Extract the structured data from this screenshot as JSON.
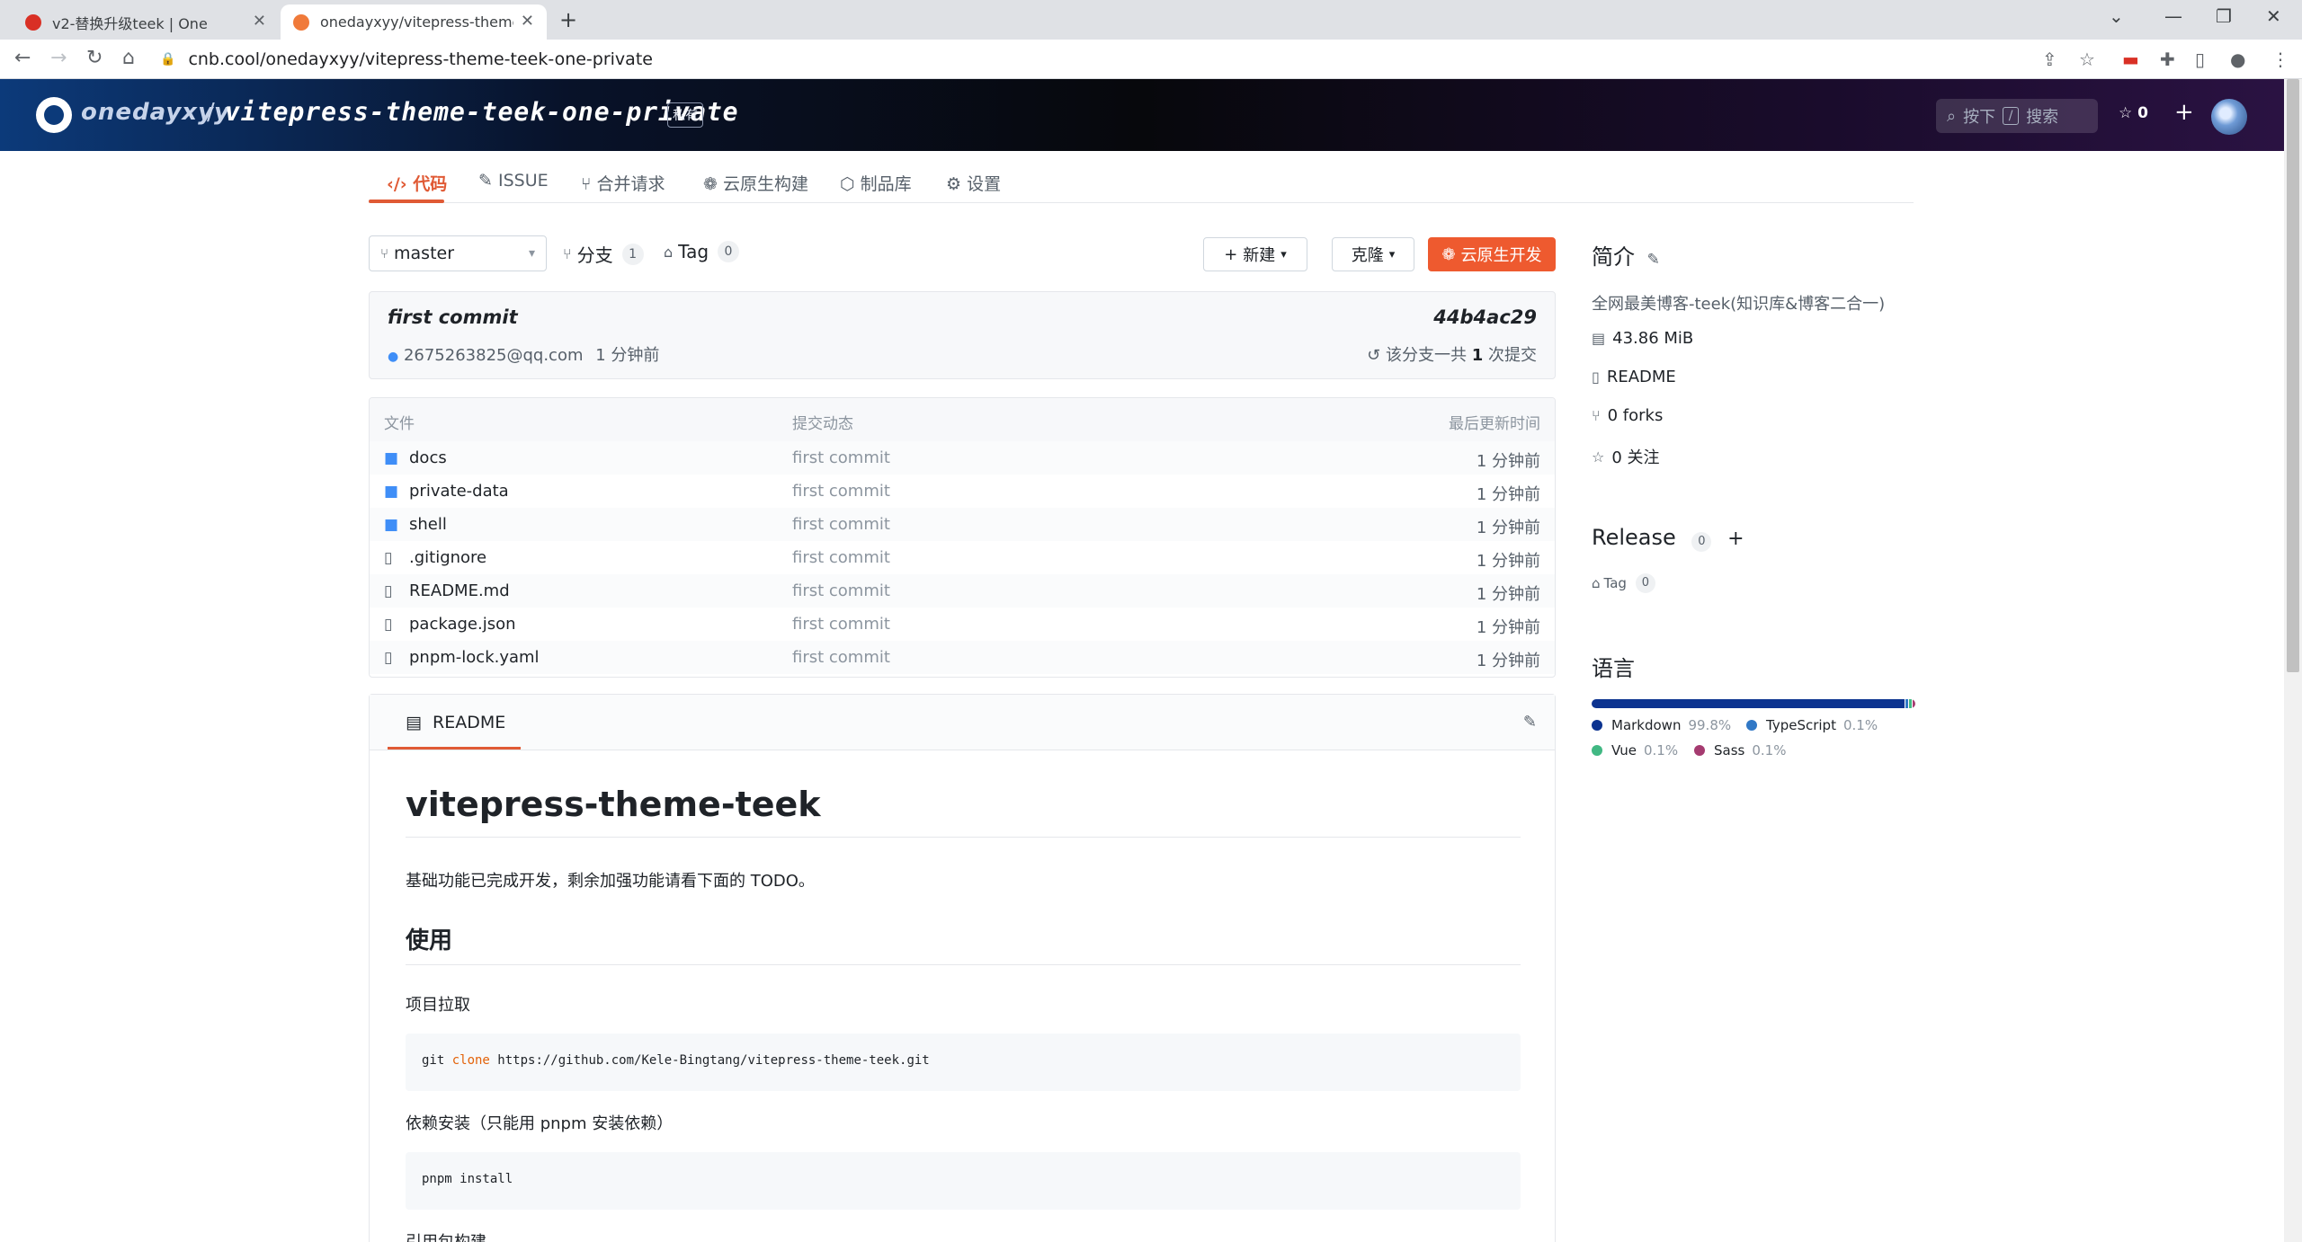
{
  "browser": {
    "tabs": [
      {
        "title": "v2-替换升级teek | One",
        "active": false
      },
      {
        "title": "onedayxyy/vitepress-theme-teek-one-private",
        "active": true
      }
    ],
    "url": "cnb.cool/onedayxyy/vitepress-theme-teek-one-private"
  },
  "header": {
    "owner": "onedayxyy",
    "separator": "/",
    "repo": "vitepress-theme-teek-one-private",
    "visibility_badge": "私有",
    "search_prefix": "按下",
    "search_key": "/",
    "search_suffix": "搜索",
    "star_count": "0"
  },
  "repo_tabs": [
    {
      "label": "代码",
      "icon": "code-icon",
      "active": true
    },
    {
      "label": "ISSUE",
      "icon": "issue-icon",
      "active": false
    },
    {
      "label": "合并请求",
      "icon": "merge-request-icon",
      "active": false
    },
    {
      "label": "云原生构建",
      "icon": "build-icon",
      "active": false
    },
    {
      "label": "制品库",
      "icon": "package-icon",
      "active": false
    },
    {
      "label": "设置",
      "icon": "settings-icon",
      "active": false
    }
  ],
  "branch_bar": {
    "branch": "master",
    "branches_label": "分支",
    "branches_count": "1",
    "tags_label": "Tag",
    "tags_count": "0",
    "new_label": "新建",
    "clone_label": "克隆",
    "cloud_dev_label": "云原生开发"
  },
  "commit": {
    "message": "first commit",
    "hash": "44b4ac29",
    "author": "2675263825@qq.com",
    "time": "1 分钟前",
    "total_prefix": "该分支一共",
    "total_count": "1",
    "total_suffix": "次提交"
  },
  "files": {
    "headers": {
      "name": "文件",
      "message": "提交动态",
      "time": "最后更新时间"
    },
    "rows": [
      {
        "name": "docs",
        "type": "folder",
        "message": "first commit",
        "time": "1 分钟前"
      },
      {
        "name": "private-data",
        "type": "folder",
        "message": "first commit",
        "time": "1 分钟前"
      },
      {
        "name": "shell",
        "type": "folder",
        "message": "first commit",
        "time": "1 分钟前"
      },
      {
        "name": ".gitignore",
        "type": "file",
        "message": "first commit",
        "time": "1 分钟前"
      },
      {
        "name": "README.md",
        "type": "file",
        "message": "first commit",
        "time": "1 分钟前"
      },
      {
        "name": "package.json",
        "type": "file",
        "message": "first commit",
        "time": "1 分钟前"
      },
      {
        "name": "pnpm-lock.yaml",
        "type": "file",
        "message": "first commit",
        "time": "1 分钟前"
      }
    ]
  },
  "readme": {
    "tab_label": "README",
    "h1": "vitepress-theme-teek",
    "intro": "基础功能已完成开发，剩余加强功能请看下面的 TODO。",
    "h2_usage": "使用",
    "step1": "项目拉取",
    "code1_cmd": "git ",
    "code1_kw": "clone",
    "code1_rest": " https://github.com/Kele-Bingtang/vitepress-theme-teek.git",
    "step2": "依赖安装（只能用 pnpm 安装依赖）",
    "code2": "pnpm install",
    "step3": "引用包构建"
  },
  "sidebar": {
    "about_title": "简介",
    "description": "全网最美博客-teek(知识库&博客二合一)",
    "size": "43.86 MiB",
    "readme_link": "README",
    "forks": "0 forks",
    "watchers": "0 关注",
    "release_title": "Release",
    "release_count": "0",
    "tag_label": "Tag",
    "tag_count": "0",
    "lang_title": "语言",
    "languages": [
      {
        "name": "Markdown",
        "percent": "99.8%",
        "share": 0.998,
        "color": "#0c3390"
      },
      {
        "name": "TypeScript",
        "percent": "0.1%",
        "share": 0.001,
        "color": "#3178c6"
      },
      {
        "name": "Vue",
        "percent": "0.1%",
        "share": 0.001,
        "color": "#41b883"
      },
      {
        "name": "Sass",
        "percent": "0.1%",
        "share": 0.001,
        "color": "#a53b70"
      }
    ]
  },
  "colors": {
    "accent": "#e05a35",
    "primary_button": "#ee5a2f",
    "folder": "#3f8ef7"
  }
}
